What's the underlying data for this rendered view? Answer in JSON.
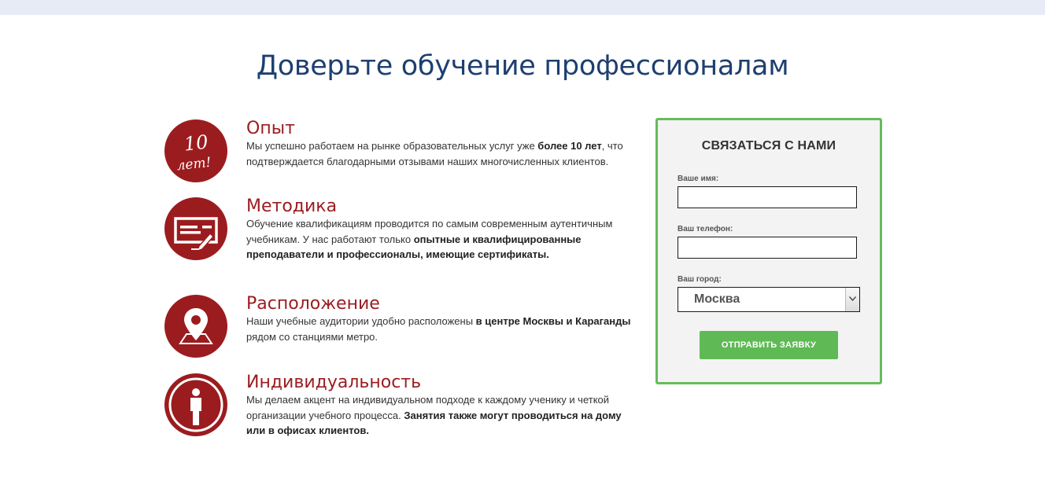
{
  "heading": "Доверьте обучение профессионалам",
  "features": [
    {
      "icon": "10-years-badge-icon",
      "icon_line1": "10",
      "icon_line2": "лет!",
      "title": "Опыт",
      "desc": [
        {
          "t": "Мы успешно работаем на рынке образовательных услуг уже ",
          "b": false
        },
        {
          "t": "более 10 лет",
          "b": true
        },
        {
          "t": ", что подтверждается благодарными отзывами наших многочисленных клиентов.",
          "b": false
        }
      ]
    },
    {
      "icon": "certificate-icon",
      "title": "Методика",
      "desc": [
        {
          "t": "Обучение квалификациям проводится по самым современным аутентичным учебникам. У нас работают только ",
          "b": false
        },
        {
          "t": "опытные и квалифицированные преподаватели и профессионалы, имеющие сертификаты.",
          "b": true
        }
      ]
    },
    {
      "icon": "map-pin-icon",
      "title": "Расположение",
      "desc": [
        {
          "t": "Наши учебные аудитории удобно расположены ",
          "b": false
        },
        {
          "t": "в центре Москвы и Караганды",
          "b": true
        },
        {
          "t": " рядом со станциями метро.",
          "b": false
        }
      ]
    },
    {
      "icon": "person-icon",
      "title": "Индивидуальность",
      "desc": [
        {
          "t": "Мы делаем акцент на индивидуальном подходе к каждому ученику и четкой организации учебного процесса. ",
          "b": false
        },
        {
          "t": "Занятия также могут проводиться на дому или в офисах клиентов.",
          "b": true
        }
      ]
    }
  ],
  "contact_form": {
    "title": "СВЯЗАТЬСЯ С НАМИ",
    "name_label": "Ваше имя:",
    "name_value": "",
    "phone_label": "Ваш телефон:",
    "phone_value": "",
    "city_label": "Ваш город:",
    "city_value": "Москва",
    "submit_label": "ОТПРАВИТЬ ЗАЯВКУ"
  },
  "colors": {
    "heading": "#1e3f70",
    "accent_red": "#9b1c1f",
    "accent_green": "#5fba55",
    "form_border": "#66bb5c"
  }
}
